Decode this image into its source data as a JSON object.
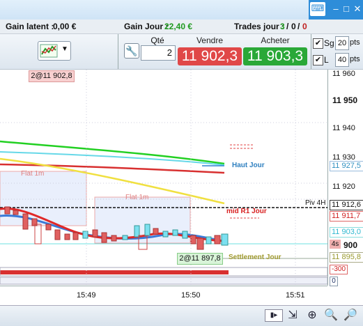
{
  "window": {
    "keyboard_icon": "keyboard-icon",
    "minimize": "–",
    "maximize": "□",
    "close": "✕"
  },
  "info": {
    "latent_label": "Gain latent :",
    "latent_value": "0,00 €",
    "day_label": "Gain Jour :",
    "day_value": "22,40 €",
    "trades_label": "Trades jour :",
    "trades_value_a": "3",
    "sep1": "/",
    "trades_value_b": "0",
    "sep2": "/",
    "trades_value_c": "0"
  },
  "toolbar": {
    "qty_label": "Qté",
    "qty_value": "2",
    "sell_label": "Vendre",
    "sell_price": "11 902,3",
    "buy_label": "Acheter",
    "buy_price": "11 903,3",
    "sg_label": "Sg",
    "sg_value": "20",
    "l_label": "L",
    "l_value": "40",
    "pts": "pts"
  },
  "chart": {
    "order_tag_top": "2@11 902,8",
    "order_tag_bottom": "2@11 897,8",
    "flat_1": "Flat 1m",
    "flat_2": "Flat 1m",
    "haut_jour": "Haut Jour",
    "piv_4h": "Piv 4H",
    "mid_r1": "mid R1 Jour",
    "settlement": "Settlement Jour",
    "counter": "4s",
    "minus_300": "-300",
    "zero": "0"
  },
  "price_axis": {
    "ticks": [
      "11 960",
      "11 950",
      "11 940",
      "11 930",
      "11 920",
      "900"
    ],
    "tags": [
      "11 927,5",
      "11 912,6",
      "11 911,7",
      "11 903,0",
      "11 895,8"
    ]
  },
  "time_axis": {
    "ticks": [
      "15:49",
      "15:50",
      "15:51"
    ]
  },
  "colors": {
    "sell": "#e04848",
    "buy": "#2aa838",
    "green_text": "#1f9a1f"
  }
}
